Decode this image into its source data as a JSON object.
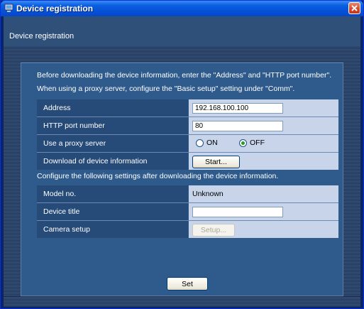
{
  "window": {
    "title": "Device registration"
  },
  "header": {
    "section_title": "Device registration"
  },
  "intro": {
    "line1": "Before downloading the device information, enter the \"Address\" and \"HTTP port number\".",
    "line2": "When using a proxy server, configure the \"Basic setup\" setting under \"Comm\"."
  },
  "form1": {
    "address_label": "Address",
    "address_value": "192.168.100.100",
    "port_label": "HTTP port number",
    "port_value": "80",
    "proxy_label": "Use a proxy server",
    "proxy_on_label": "ON",
    "proxy_off_label": "OFF",
    "proxy_selected": "OFF",
    "download_label": "Download of device information",
    "start_button": "Start..."
  },
  "after_note": "Configure the following settings after downloading the device information.",
  "form2": {
    "model_label": "Model no.",
    "model_value": "Unknown",
    "title_label": "Device title",
    "title_value": "",
    "camera_label": "Camera setup",
    "setup_button": "Setup..."
  },
  "set_button": "Set",
  "colors": {
    "titlebar": "#0a5fe0",
    "panel": "#2e5a8c",
    "label_cell": "#274b78",
    "value_cell": "#c7d4ea",
    "radio_selected": "#21a121"
  },
  "icons": {
    "app": "monitor-icon",
    "close": "close-icon"
  }
}
